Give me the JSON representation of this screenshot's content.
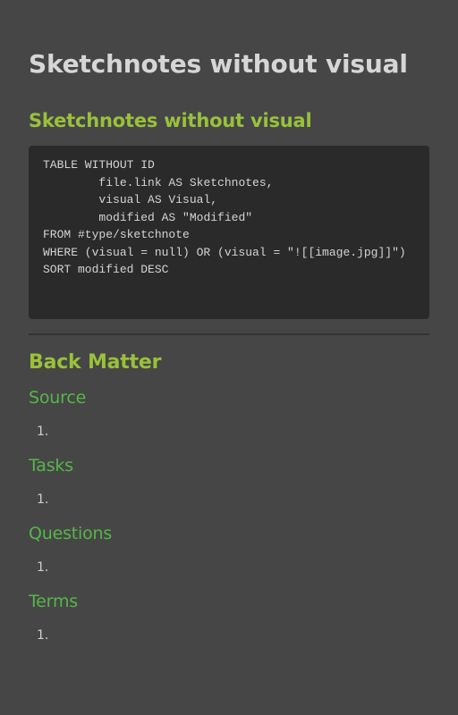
{
  "page": {
    "title": "Sketchnotes without visual"
  },
  "query_section": {
    "heading": "Sketchnotes without visual",
    "code_lines": [
      "TABLE WITHOUT ID",
      "        file.link AS Sketchnotes,",
      "        visual AS Visual,",
      "        modified AS \"Modified\"",
      "FROM #type/sketchnote",
      "WHERE (visual = null) OR (visual = \"![[image.jpg]]\")",
      "SORT modified DESC"
    ]
  },
  "back_matter": {
    "heading": "Back Matter",
    "sections": [
      {
        "heading": "Source",
        "items": [
          "1."
        ]
      },
      {
        "heading": "Tasks",
        "items": [
          "1."
        ]
      },
      {
        "heading": "Questions",
        "items": [
          "1."
        ]
      },
      {
        "heading": "Terms",
        "items": [
          "1."
        ]
      }
    ]
  },
  "colors": {
    "background": "#464646",
    "code_background": "#2a2a2a",
    "h2": "#99c13a",
    "h3": "#56b649"
  }
}
